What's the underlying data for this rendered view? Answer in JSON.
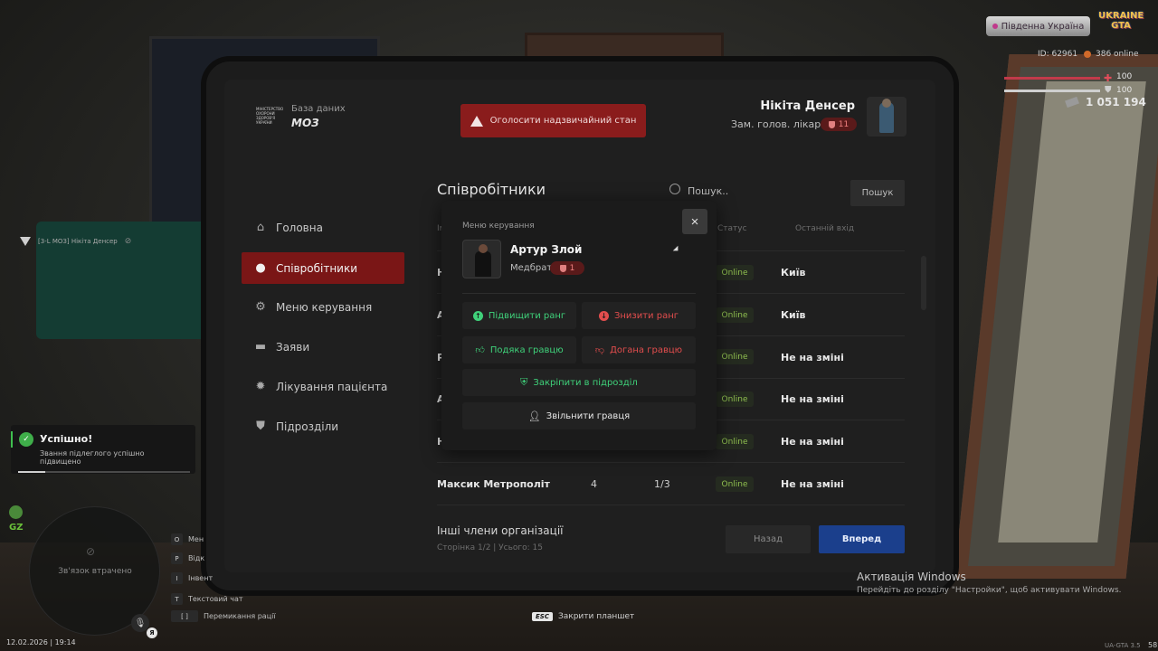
{
  "app": {
    "db_label": "База даних",
    "db_name": "МОЗ",
    "logo_text": "МІНІСТЕРСТВО ОХОРОНИ ЗДОРОВ'Я УКРАЇНИ",
    "emergency_label": "Оголосити надзвичайний стан",
    "user": {
      "name": "Нікіта Денсер",
      "role": "Зам. голов. лікаря",
      "rank": "11"
    }
  },
  "sidebar": {
    "items": [
      {
        "label": "Головна",
        "icon": "home-icon",
        "active": false
      },
      {
        "label": "Співробітники",
        "icon": "users-icon",
        "active": true
      },
      {
        "label": "Меню керування",
        "icon": "gear-icon",
        "active": false
      },
      {
        "label": "Заяви",
        "icon": "folder-icon",
        "active": false
      },
      {
        "label": "Лікування пацієнта",
        "icon": "virus-icon",
        "active": false
      },
      {
        "label": "Підрозділи",
        "icon": "shield-icon",
        "active": false
      }
    ]
  },
  "main": {
    "title": "Співробітники",
    "search_placeholder": "Пошук..",
    "search_button": "Пошук",
    "columns": {
      "name": "Ім",
      "status": "Статус",
      "last_login": "Останній вхід"
    },
    "rows": [
      {
        "name": "Н",
        "rank": "",
        "warns": "",
        "status": "Online",
        "last": "Київ"
      },
      {
        "name": "А",
        "rank": "",
        "warns": "",
        "status": "Online",
        "last": "Київ"
      },
      {
        "name": "Р",
        "rank": "",
        "warns": "",
        "status": "Online",
        "last": "Не на зміні"
      },
      {
        "name": "А",
        "rank": "",
        "warns": "",
        "status": "Online",
        "last": "Не на зміні"
      },
      {
        "name": "Н",
        "rank": "",
        "warns": "",
        "status": "Online",
        "last": "Не на зміні"
      },
      {
        "name": "Максик Метрополіт",
        "rank": "4",
        "warns": "1/3",
        "status": "Online",
        "last": "Не на зміні"
      }
    ],
    "others_title": "Інші члени організації",
    "page_info": "Сторінка 1/2 | Усього: 15",
    "back_label": "Назад",
    "next_label": "Вперед"
  },
  "modal": {
    "label": "Меню керування",
    "close": "×",
    "member": {
      "name": "Артур Злой",
      "role": "Медбрат",
      "rank": "1"
    },
    "actions": {
      "promote": "Підвищити ранг",
      "demote": "Знизити ранг",
      "thanks": "Подяка гравцю",
      "reprimand": "Догана гравцю",
      "assign": "Закріпити в підрозділ",
      "fire": "Звільнити гравця"
    }
  },
  "hud": {
    "server": "Південна Україна",
    "game_logo": "UKRAINE GTA",
    "id": "ID: 62961",
    "online": "386 online",
    "health": "100",
    "armor": "100",
    "health_fill": 1.0,
    "armor_fill": 1.0,
    "money": "1 051 194",
    "voice_text": "[3-L МОЗ] Нікіта Денсер",
    "toast": {
      "title": "Успішно!",
      "text": "Звання підлеглого успішно підвищено",
      "progress": 0.16
    },
    "gz": "GZ",
    "radar_text": "Зв'язок втрачено",
    "mic_key": "Я",
    "keys": [
      {
        "key": "O",
        "label": "Мен"
      },
      {
        "key": "P",
        "label": "Відк"
      },
      {
        "key": "I",
        "label": "Інвент"
      },
      {
        "key": "T",
        "label": "Текстовий чат"
      },
      {
        "key": "[  ]",
        "label": "Перемикання рації"
      }
    ],
    "datetime": "12.02.2026 | 19:14",
    "esc_key": "ESC",
    "esc_label": "Закрити планшет",
    "version": "UA-GTA 3.5",
    "version_short": "58"
  },
  "windows": {
    "title": "Активація Windows",
    "text": "Перейдіть до розділу \"Настройки\", щоб активувати Windows."
  },
  "colors": {
    "accent_red": "#7a1616",
    "next_blue": "#1b3f8c",
    "online_green": "#8fbf4f",
    "success_green": "#3fae4a"
  }
}
